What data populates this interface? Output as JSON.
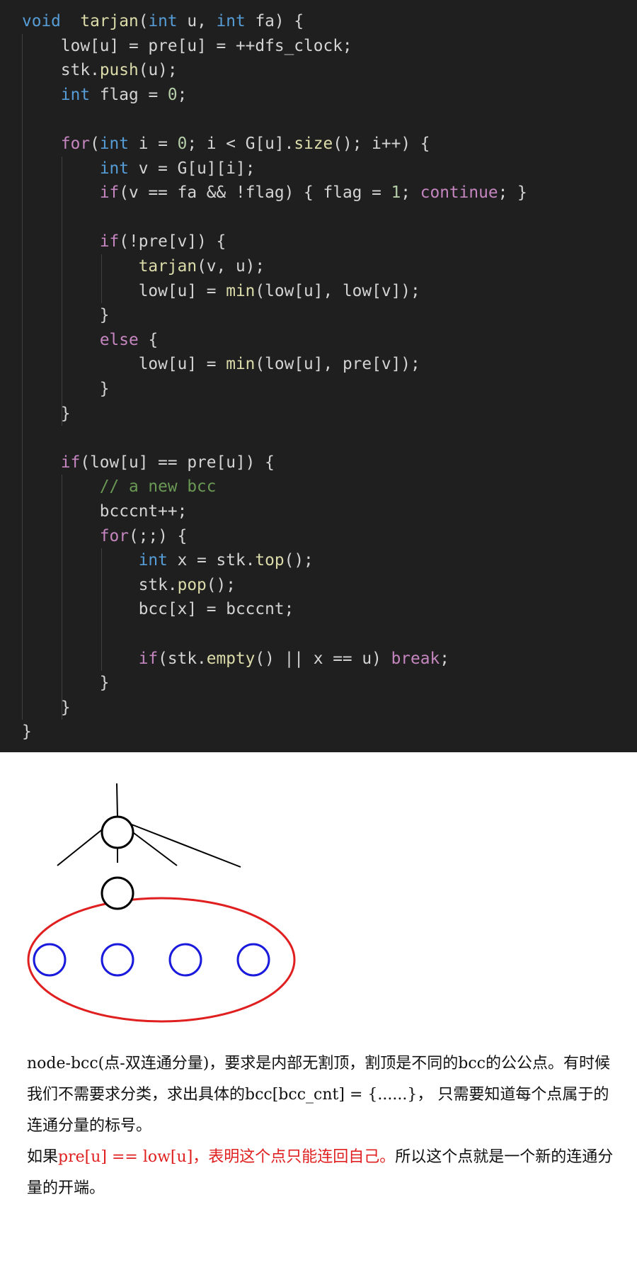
{
  "code": {
    "lines": [
      [
        [
          "kw",
          "void"
        ],
        [
          "",
          "  "
        ],
        [
          "fn",
          "tarjan"
        ],
        [
          "",
          "("
        ],
        [
          "kw",
          "int"
        ],
        [
          "",
          " u, "
        ],
        [
          "kw",
          "int"
        ],
        [
          "",
          " fa) {"
        ]
      ],
      [
        [
          "",
          "    low[u] = pre[u] = ++dfs_clock;"
        ]
      ],
      [
        [
          "",
          "    stk."
        ],
        [
          "fn",
          "push"
        ],
        [
          "",
          "(u);"
        ]
      ],
      [
        [
          "",
          "    "
        ],
        [
          "kw",
          "int"
        ],
        [
          "",
          " flag = "
        ],
        [
          "num",
          "0"
        ],
        [
          "",
          ";"
        ]
      ],
      [],
      [
        [
          "",
          "    "
        ],
        [
          "ctl",
          "for"
        ],
        [
          "",
          "("
        ],
        [
          "kw",
          "int"
        ],
        [
          "",
          " i = "
        ],
        [
          "num",
          "0"
        ],
        [
          "",
          "; i < G[u]."
        ],
        [
          "fn",
          "size"
        ],
        [
          "",
          "(); i++) {"
        ]
      ],
      [
        [
          "",
          "        "
        ],
        [
          "kw",
          "int"
        ],
        [
          "",
          " v = G[u][i];"
        ]
      ],
      [
        [
          "",
          "        "
        ],
        [
          "ctl",
          "if"
        ],
        [
          "",
          "(v == fa && !flag) { flag = "
        ],
        [
          "num",
          "1"
        ],
        [
          "",
          "; "
        ],
        [
          "ctl",
          "continue"
        ],
        [
          "",
          "; }"
        ]
      ],
      [],
      [
        [
          "",
          "        "
        ],
        [
          "ctl",
          "if"
        ],
        [
          "",
          "(!pre[v]) {"
        ]
      ],
      [
        [
          "",
          "            "
        ],
        [
          "fn",
          "tarjan"
        ],
        [
          "",
          "(v, u);"
        ]
      ],
      [
        [
          "",
          "            low[u] = "
        ],
        [
          "fn",
          "min"
        ],
        [
          "",
          "(low[u], low[v]);"
        ]
      ],
      [
        [
          "",
          "        }"
        ]
      ],
      [
        [
          "",
          "        "
        ],
        [
          "ctl",
          "else"
        ],
        [
          "",
          " {"
        ]
      ],
      [
        [
          "",
          "            low[u] = "
        ],
        [
          "fn",
          "min"
        ],
        [
          "",
          "(low[u], pre[v]);"
        ]
      ],
      [
        [
          "",
          "        }"
        ]
      ],
      [
        [
          "",
          "    }"
        ]
      ],
      [],
      [
        [
          "",
          "    "
        ],
        [
          "ctl",
          "if"
        ],
        [
          "",
          "(low[u] == pre[u]) {"
        ]
      ],
      [
        [
          "",
          "        "
        ],
        [
          "cmt",
          "// a new bcc"
        ]
      ],
      [
        [
          "",
          "        bcccnt++;"
        ]
      ],
      [
        [
          "",
          "        "
        ],
        [
          "ctl",
          "for"
        ],
        [
          "",
          "(;;) {"
        ]
      ],
      [
        [
          "",
          "            "
        ],
        [
          "kw",
          "int"
        ],
        [
          "",
          " x = stk."
        ],
        [
          "fn",
          "top"
        ],
        [
          "",
          "();"
        ]
      ],
      [
        [
          "",
          "            stk."
        ],
        [
          "fn",
          "pop"
        ],
        [
          "",
          "();"
        ]
      ],
      [
        [
          "",
          "            bcc[x] = bcccnt;"
        ]
      ],
      [],
      [
        [
          "",
          "            "
        ],
        [
          "ctl",
          "if"
        ],
        [
          "",
          "(stk."
        ],
        [
          "fn",
          "empty"
        ],
        [
          "",
          "() || x == u) "
        ],
        [
          "ctl",
          "break"
        ],
        [
          "",
          ";"
        ]
      ],
      [
        [
          "",
          "        }"
        ]
      ],
      [
        [
          "",
          "    }"
        ]
      ],
      [
        [
          "",
          "}"
        ]
      ]
    ]
  },
  "diagram": {
    "root_node_color": "#000000",
    "child_node_color": "#1a1adc",
    "bcc_ellipse_color": "#e02020",
    "child_count": 4
  },
  "text": {
    "p1": "node-bcc(点-双连通分量)，要求是内部无割顶，割顶是不同的bcc的公公点。有时候我们不需要求分类，求出具体的bcc[bcc_cnt] = {......}， 只需要知道每个点属于的连通分量的标号。",
    "p2_prefix": "如果",
    "p2_highlight": "pre[u] == low[u]，表明这个点只能连回自己。",
    "p2_suffix": "所以这个点就是一个新的连通分量的开端。",
    "highlight_color": "#e02020"
  }
}
